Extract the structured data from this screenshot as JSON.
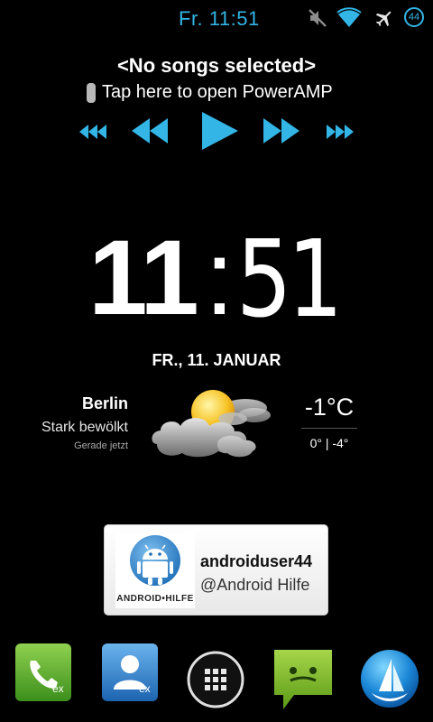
{
  "status_bar": {
    "time": "Fr. 11:51",
    "icons": [
      "mute-icon",
      "wifi-icon",
      "airplane-icon",
      "notification-count-icon"
    ],
    "notification_count": "44",
    "accent_color": "#33b5e5"
  },
  "music_widget": {
    "title": "<No songs selected>",
    "subtitle": "Tap here to open PowerAMP",
    "controls": [
      "previous-list-icon",
      "rewind-icon",
      "play-icon",
      "fast-forward-icon",
      "next-list-icon"
    ]
  },
  "clock_widget": {
    "hours": "11",
    "separator": ":",
    "minutes": "51",
    "date": "FR., 11. JANUAR"
  },
  "weather_widget": {
    "city": "Berlin",
    "condition": "Stark bewölkt",
    "updated": "Gerade jetzt",
    "temperature": "-1°C",
    "range": "0° | -4°",
    "icon": "cloudy-sun-icon"
  },
  "twitter_card": {
    "logo_text": "ANDROID•HILFE",
    "username": "androiduser44",
    "handle": "@Android Hilfe"
  },
  "dock": {
    "items": [
      {
        "icon": "phone-icon",
        "label": "ex"
      },
      {
        "icon": "contacts-icon",
        "label": "ex"
      },
      {
        "icon": "app-drawer-icon",
        "label": ""
      },
      {
        "icon": "messaging-icon",
        "label": ""
      },
      {
        "icon": "browser-icon",
        "label": ""
      }
    ]
  }
}
